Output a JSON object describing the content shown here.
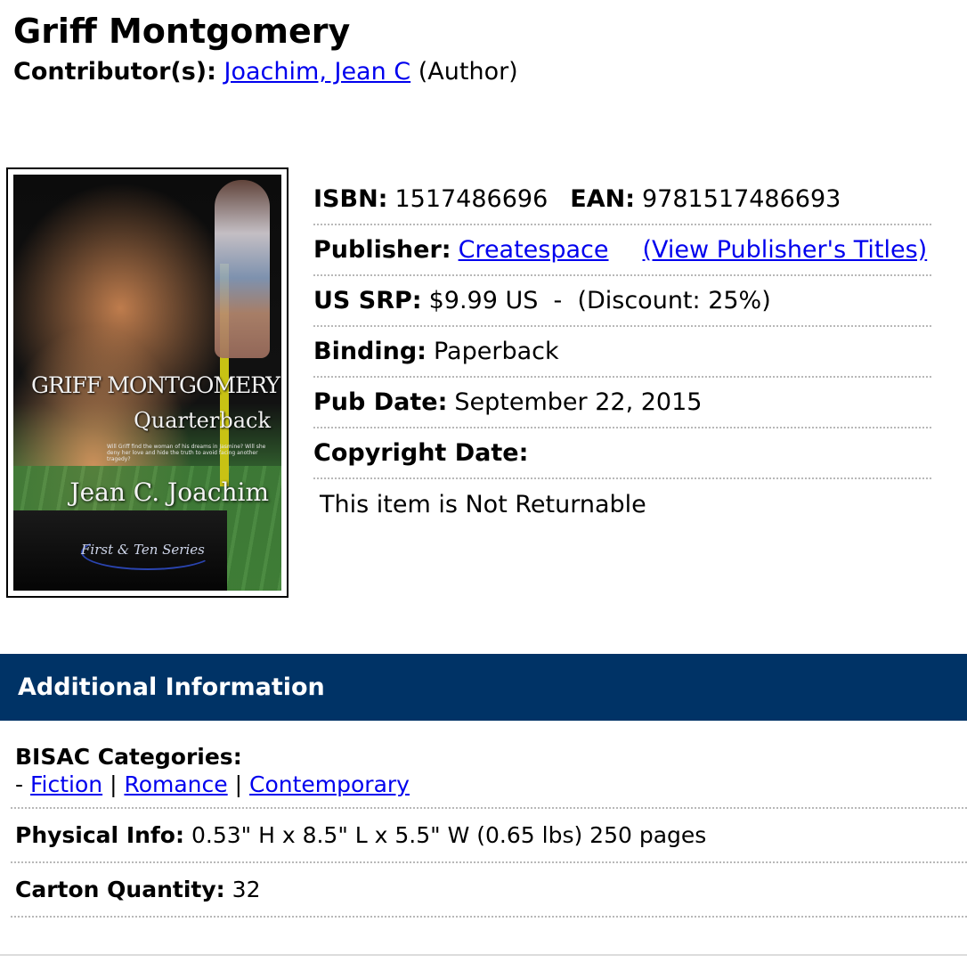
{
  "book": {
    "title": "Griff Montgomery",
    "contributors_label": "Contributor(s):",
    "contributor_name": "Joachim, Jean C",
    "contributor_role": "(Author)"
  },
  "cover": {
    "title_text": "GRIFF MONTGOMERY",
    "subtitle_text": "Quarterback",
    "blurb": "Will Griff find the woman of his dreams in Jasmine? Will she deny her love and hide the truth to avoid facing another tragedy?",
    "author_text": "Jean C. Joachim",
    "series_text": "First & Ten Series"
  },
  "details": {
    "isbn_label": "ISBN:",
    "isbn": "1517486696",
    "ean_label": "EAN:",
    "ean": "9781517486693",
    "publisher_label": "Publisher:",
    "publisher": "Createspace",
    "view_titles": "(View Publisher's Titles)",
    "srp_label": "US SRP:",
    "srp": "$9.99 US  -  (Discount: 25%)",
    "binding_label": "Binding:",
    "binding": "Paperback",
    "pubdate_label": "Pub Date:",
    "pubdate": "September 22, 2015",
    "copyright_label": "Copyright Date:",
    "copyright": "",
    "returnable": "This item is Not Returnable"
  },
  "additional": {
    "header": "Additional Information",
    "bisac_label": "BISAC Categories:",
    "bisac_prefix": "-",
    "bisac_sep": "|",
    "categories": [
      "Fiction",
      "Romance",
      "Contemporary"
    ],
    "physical_label": "Physical Info:",
    "physical": "0.53\" H x 8.5\" L x 5.5\" W (0.65 lbs) 250 pages",
    "carton_label": "Carton Quantity:",
    "carton": "32"
  },
  "colors": {
    "header_bar": "#003366",
    "link": "#0000ee"
  }
}
